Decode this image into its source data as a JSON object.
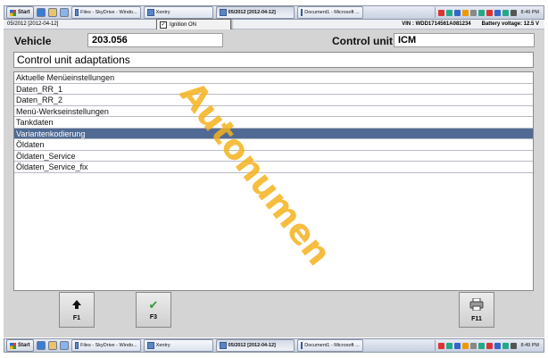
{
  "taskbar_top": {
    "start": "Start",
    "tasks": [
      "Files - SkyDrive - Windo...",
      "Xentry",
      "05/2012 [2012-04-12]",
      "Document1 - Microsoft ..."
    ],
    "active_task_index": 2,
    "clock": "8:49 PM"
  },
  "taskbar_bottom": {
    "start": "Start",
    "tasks": [
      "Files - SkyDrive - Windo...",
      "Xentry",
      "05/2012 [2012-04-12]",
      "Document1 - Microsoft ..."
    ],
    "active_task_index": 2,
    "clock": "8:49 PM"
  },
  "status": {
    "version": "05/2012 [2012-04-12]",
    "vin": "VIN : WDD1714561A081234",
    "battery": "Battery voltage: 12.5 V"
  },
  "popup": {
    "label": "Ignition ON",
    "checked": true
  },
  "vehicle": {
    "label": "Vehicle",
    "value": "203.056"
  },
  "control_unit": {
    "label": "Control unit",
    "value": "ICM"
  },
  "section_title": "Control unit adaptations",
  "list": {
    "items": [
      "Aktuelle Menüeinstellungen",
      "Daten_RR_1",
      "Daten_RR_2",
      "Menü-Werkseinstellungen",
      "Tankdaten",
      "Variantenkodierung",
      "Öldaten",
      "Öldaten_Service",
      "Öldaten_Service_fix"
    ],
    "selected_index": 5
  },
  "fkeys": {
    "f1": {
      "label": "F1",
      "icon": "arrow-up-icon",
      "glyph": "🠅"
    },
    "f3": {
      "label": "F3",
      "icon": "checkmark-icon",
      "glyph": "✔"
    },
    "f11": {
      "label": "F11",
      "icon": "printer-icon",
      "glyph": "🖶"
    }
  },
  "watermark": "Autonumen",
  "colors": {
    "selection": "#506a93",
    "watermark_orange": "#f5b21c",
    "watermark_blue": "#4a8fe0"
  }
}
